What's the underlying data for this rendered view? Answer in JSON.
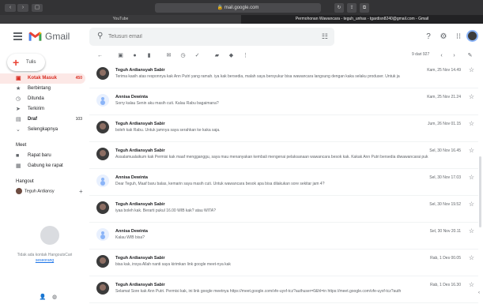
{
  "browser": {
    "url": "mail.google.com",
    "tabs": [
      {
        "label": "YouTube"
      },
      {
        "label": "Permohonan Wawancara - teguh_unhas - tgardisn8240@gmail.com - Gmail"
      }
    ]
  },
  "header": {
    "app_name": "Gmail",
    "search_placeholder": "Telusuri email"
  },
  "sidebar": {
    "compose_label": "Tulis",
    "items": [
      {
        "label": "Kotak Masuk",
        "count": "450",
        "icon": "inbox-icon",
        "active": true
      },
      {
        "label": "Berbintang",
        "count": "",
        "icon": "star-icon"
      },
      {
        "label": "Ditunda",
        "count": "",
        "icon": "clock-icon"
      },
      {
        "label": "Terkirim",
        "count": "",
        "icon": "send-icon"
      },
      {
        "label": "Draf",
        "count": "103",
        "icon": "draft-icon"
      },
      {
        "label": "Selengkapnya",
        "count": "",
        "icon": "chevron-down-icon"
      }
    ],
    "meet": {
      "title": "Meet",
      "items": [
        {
          "label": "Rapat baru",
          "icon": "video-icon"
        },
        {
          "label": "Gabung ke rapat",
          "icon": "keyboard-icon"
        }
      ]
    },
    "hangout": {
      "title": "Hangout",
      "user": "Teguh Ardiansy",
      "no_contacts": "Tidak ada kontak Hangouts",
      "no_contacts_cont": "Cari",
      "search_link": "seseorang"
    }
  },
  "toolbar": {
    "pager": "9 dari 927"
  },
  "emails": [
    {
      "sender": "Teguh Ardiansyah Sabir",
      "snippet": "Terima kasih atas responnya kak Ann Putri yang ramah. iya kak bersedia, malah saya bersyukur bisa wawancara langsung dengan kaka selaku produser. Untuk ja",
      "date": "Kam, 25 Nov 14.49",
      "avatar": "photo"
    },
    {
      "sender": "Annisa Dewinta",
      "snippet": "Sorry kalau Senin aku masih cuti. Kalau Rabu bagaimana?",
      "date": "Kam, 25 Nov 21.24",
      "avatar": "default"
    },
    {
      "sender": "Teguh Ardiansyah Sabir",
      "snippet": "boleh kak Rabu. Untuk jamnya saya serahkan ke kaka saja.",
      "date": "Jum, 26 Nov 01.15",
      "avatar": "photo"
    },
    {
      "sender": "Teguh Ardiansyah Sabir",
      "snippet": "Assalamualaikum kak Permisi kak maaf mengganggu, saya mau menanyakan kembali mengenai pelaksanaan wawancara besok kak. Kakak Ann Putri bersedia diwawancarai puk",
      "date": "Sel, 30 Nov 16.45",
      "avatar": "photo"
    },
    {
      "sender": "Annisa Dewinta",
      "snippet": "Dear Teguh, Maaf baru balas, kemarin saya masih cuti. Untuk wawancara besok apa bisa dilakukan sore sekitar jam 4?",
      "date": "Sel, 30 Nov 17.03",
      "avatar": "default"
    },
    {
      "sender": "Teguh Ardiansyah Sabir",
      "snippet": "iyaa boleh kak. Berarti pukul 16.00 WIB kak? atau WITA?",
      "date": "Sel, 30 Nov 19.52",
      "avatar": "photo"
    },
    {
      "sender": "Annisa Dewinta",
      "snippet": "Kalau WIB bisa?",
      "date": "Sel, 30 Nov 20.11",
      "avatar": "default"
    },
    {
      "sender": "Teguh Ardiansyah Sabir",
      "snippet": "bisa kak, insya Allah nanti saya kirimkan link google meet-nya kak",
      "date": "Rab, 1 Des 00.05",
      "avatar": "photo"
    },
    {
      "sender": "Teguh Ardiansyah Sabir",
      "snippet": "Selamat Sore kak Ann Putri. Permisi kak, ini link google meetnya https://meet.google.com/vfe-uyxf-tcz?authuser=0&hl=in https://meet.google.com/vfe-uyxf-tcz?auth",
      "date": "Rab, 1 Des 16.30",
      "avatar": "photo"
    }
  ]
}
